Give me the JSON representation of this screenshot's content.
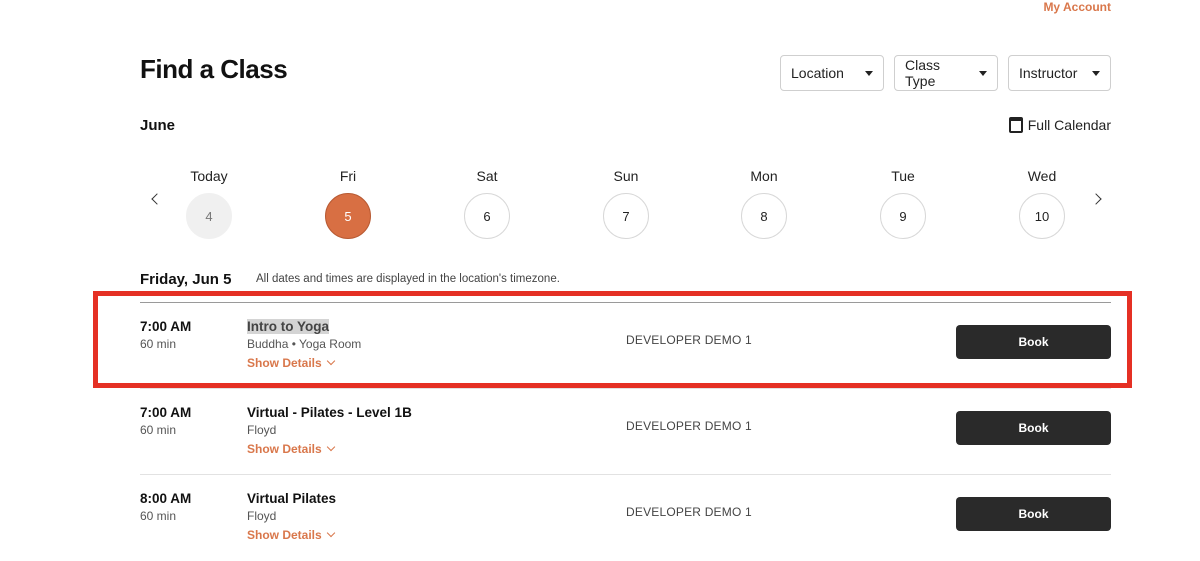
{
  "header": {
    "my_account": "My Account",
    "title": "Find a Class"
  },
  "filters": {
    "location": "Location",
    "class_type": "Class Type",
    "instructor": "Instructor"
  },
  "calendar": {
    "month": "June",
    "full_calendar": "Full Calendar",
    "days": [
      {
        "label": "Today",
        "number": "4"
      },
      {
        "label": "Fri",
        "number": "5"
      },
      {
        "label": "Sat",
        "number": "6"
      },
      {
        "label": "Sun",
        "number": "7"
      },
      {
        "label": "Mon",
        "number": "8"
      },
      {
        "label": "Tue",
        "number": "9"
      },
      {
        "label": "Wed",
        "number": "10"
      }
    ]
  },
  "schedule": {
    "date_heading": "Friday, Jun 5",
    "timezone_note": "All dates and times are displayed in the location's timezone.",
    "classes": [
      {
        "time": "7:00 AM",
        "duration": "60 min",
        "name": "Intro to Yoga",
        "meta": "Buddha • Yoga Room",
        "details": "Show Details",
        "studio": "DEVELOPER DEMO 1",
        "book": "Book"
      },
      {
        "time": "7:00 AM",
        "duration": "60 min",
        "name": "Virtual - Pilates - Level 1B",
        "meta": "Floyd",
        "details": "Show Details",
        "studio": "DEVELOPER DEMO 1",
        "book": "Book"
      },
      {
        "time": "8:00 AM",
        "duration": "60 min",
        "name": "Virtual Pilates",
        "meta": "Floyd",
        "details": "Show Details",
        "studio": "DEVELOPER DEMO 1",
        "book": "Book"
      }
    ]
  },
  "colors": {
    "accent": "#d86f43",
    "link": "#d9774b",
    "button": "#2a2a2a",
    "highlight": "#e53024"
  }
}
